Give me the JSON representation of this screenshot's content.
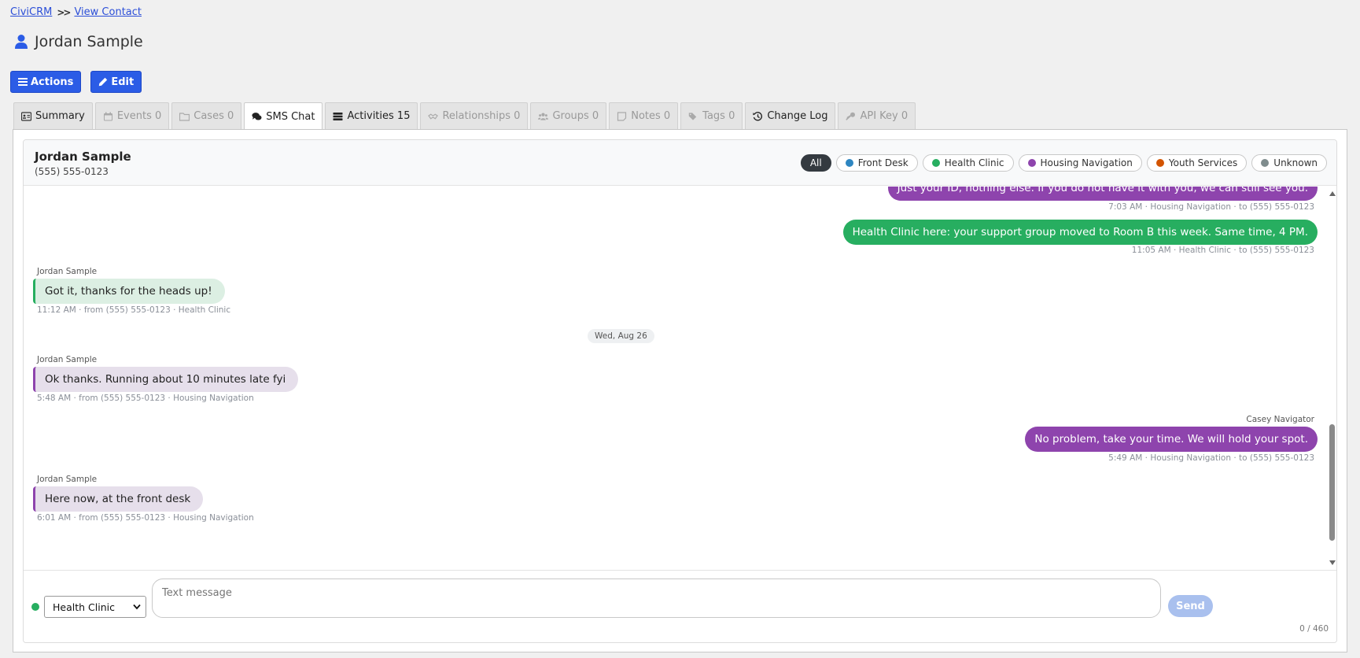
{
  "breadcrumb": {
    "home": "CiviCRM",
    "current": "View Contact"
  },
  "page": {
    "title": "Jordan Sample"
  },
  "toolbar": {
    "actions_label": "Actions",
    "edit_label": "Edit"
  },
  "tabs": [
    {
      "label": "Summary",
      "icon": "id-card-icon",
      "state": "enabled"
    },
    {
      "label": "Events 0",
      "icon": "calendar-icon",
      "state": "disabled"
    },
    {
      "label": "Cases 0",
      "icon": "folder-icon",
      "state": "disabled"
    },
    {
      "label": "SMS Chat",
      "icon": "comments-icon",
      "state": "active"
    },
    {
      "label": "Activities 15",
      "icon": "tasks-icon",
      "state": "enabled"
    },
    {
      "label": "Relationships 0",
      "icon": "handshake-icon",
      "state": "disabled"
    },
    {
      "label": "Groups 0",
      "icon": "users-icon",
      "state": "disabled"
    },
    {
      "label": "Notes 0",
      "icon": "note-icon",
      "state": "disabled"
    },
    {
      "label": "Tags 0",
      "icon": "tags-icon",
      "state": "disabled"
    },
    {
      "label": "Change Log",
      "icon": "history-icon",
      "state": "enabled"
    },
    {
      "label": "API Key 0",
      "icon": "key-icon",
      "state": "disabled"
    }
  ],
  "chat": {
    "contact_name": "Jordan Sample",
    "contact_phone": "(555) 555-0123",
    "filters": [
      {
        "label": "All",
        "active": true,
        "color": ""
      },
      {
        "label": "Front Desk",
        "active": false,
        "color": "#2e86c1"
      },
      {
        "label": "Health Clinic",
        "active": false,
        "color": "#27ae60"
      },
      {
        "label": "Housing Navigation",
        "active": false,
        "color": "#8e44ad"
      },
      {
        "label": "Youth Services",
        "active": false,
        "color": "#d35400"
      },
      {
        "label": "Unknown",
        "active": false,
        "color": "#7f8c8d"
      }
    ],
    "channel_colors": {
      "housing_out": "#8e44ad",
      "health_out": "#27ae60",
      "health_in_bg": "#dcefe3",
      "housing_in_bg": "#e6dfeb"
    },
    "messages": [
      {
        "text": "Just your ID, nothing else. If you do not have it with you, we can still see you.",
        "meta": "7:03 AM · Housing Navigation · to (555) 555-0123"
      },
      {
        "text": "Health Clinic here: your support group moved to Room B this week. Same time, 4 PM.",
        "meta": "11:05 AM · Health Clinic · to (555) 555-0123"
      },
      {
        "sender": "Jordan Sample",
        "text": "Got it, thanks for the heads up!",
        "meta": "11:12 AM · from (555) 555-0123 · Health Clinic"
      },
      {
        "sender": "Jordan Sample",
        "text": "Ok thanks. Running about 10 minutes late fyi",
        "meta": "5:48 AM · from (555) 555-0123 · Housing Navigation"
      },
      {
        "sender": "Casey Navigator",
        "text": "No problem, take your time. We will hold your spot.",
        "meta": "5:49 AM · Housing Navigation · to (555) 555-0123"
      },
      {
        "sender": "Jordan Sample",
        "text": "Here now, at the front desk",
        "meta": "6:01 AM · from (555) 555-0123 · Housing Navigation"
      }
    ],
    "date_separator": "Wed, Aug 26"
  },
  "composer": {
    "channel": "Health Clinic",
    "channel_color": "#27ae60",
    "placeholder": "Text message",
    "send_label": "Send",
    "counter": "0 / 460"
  }
}
